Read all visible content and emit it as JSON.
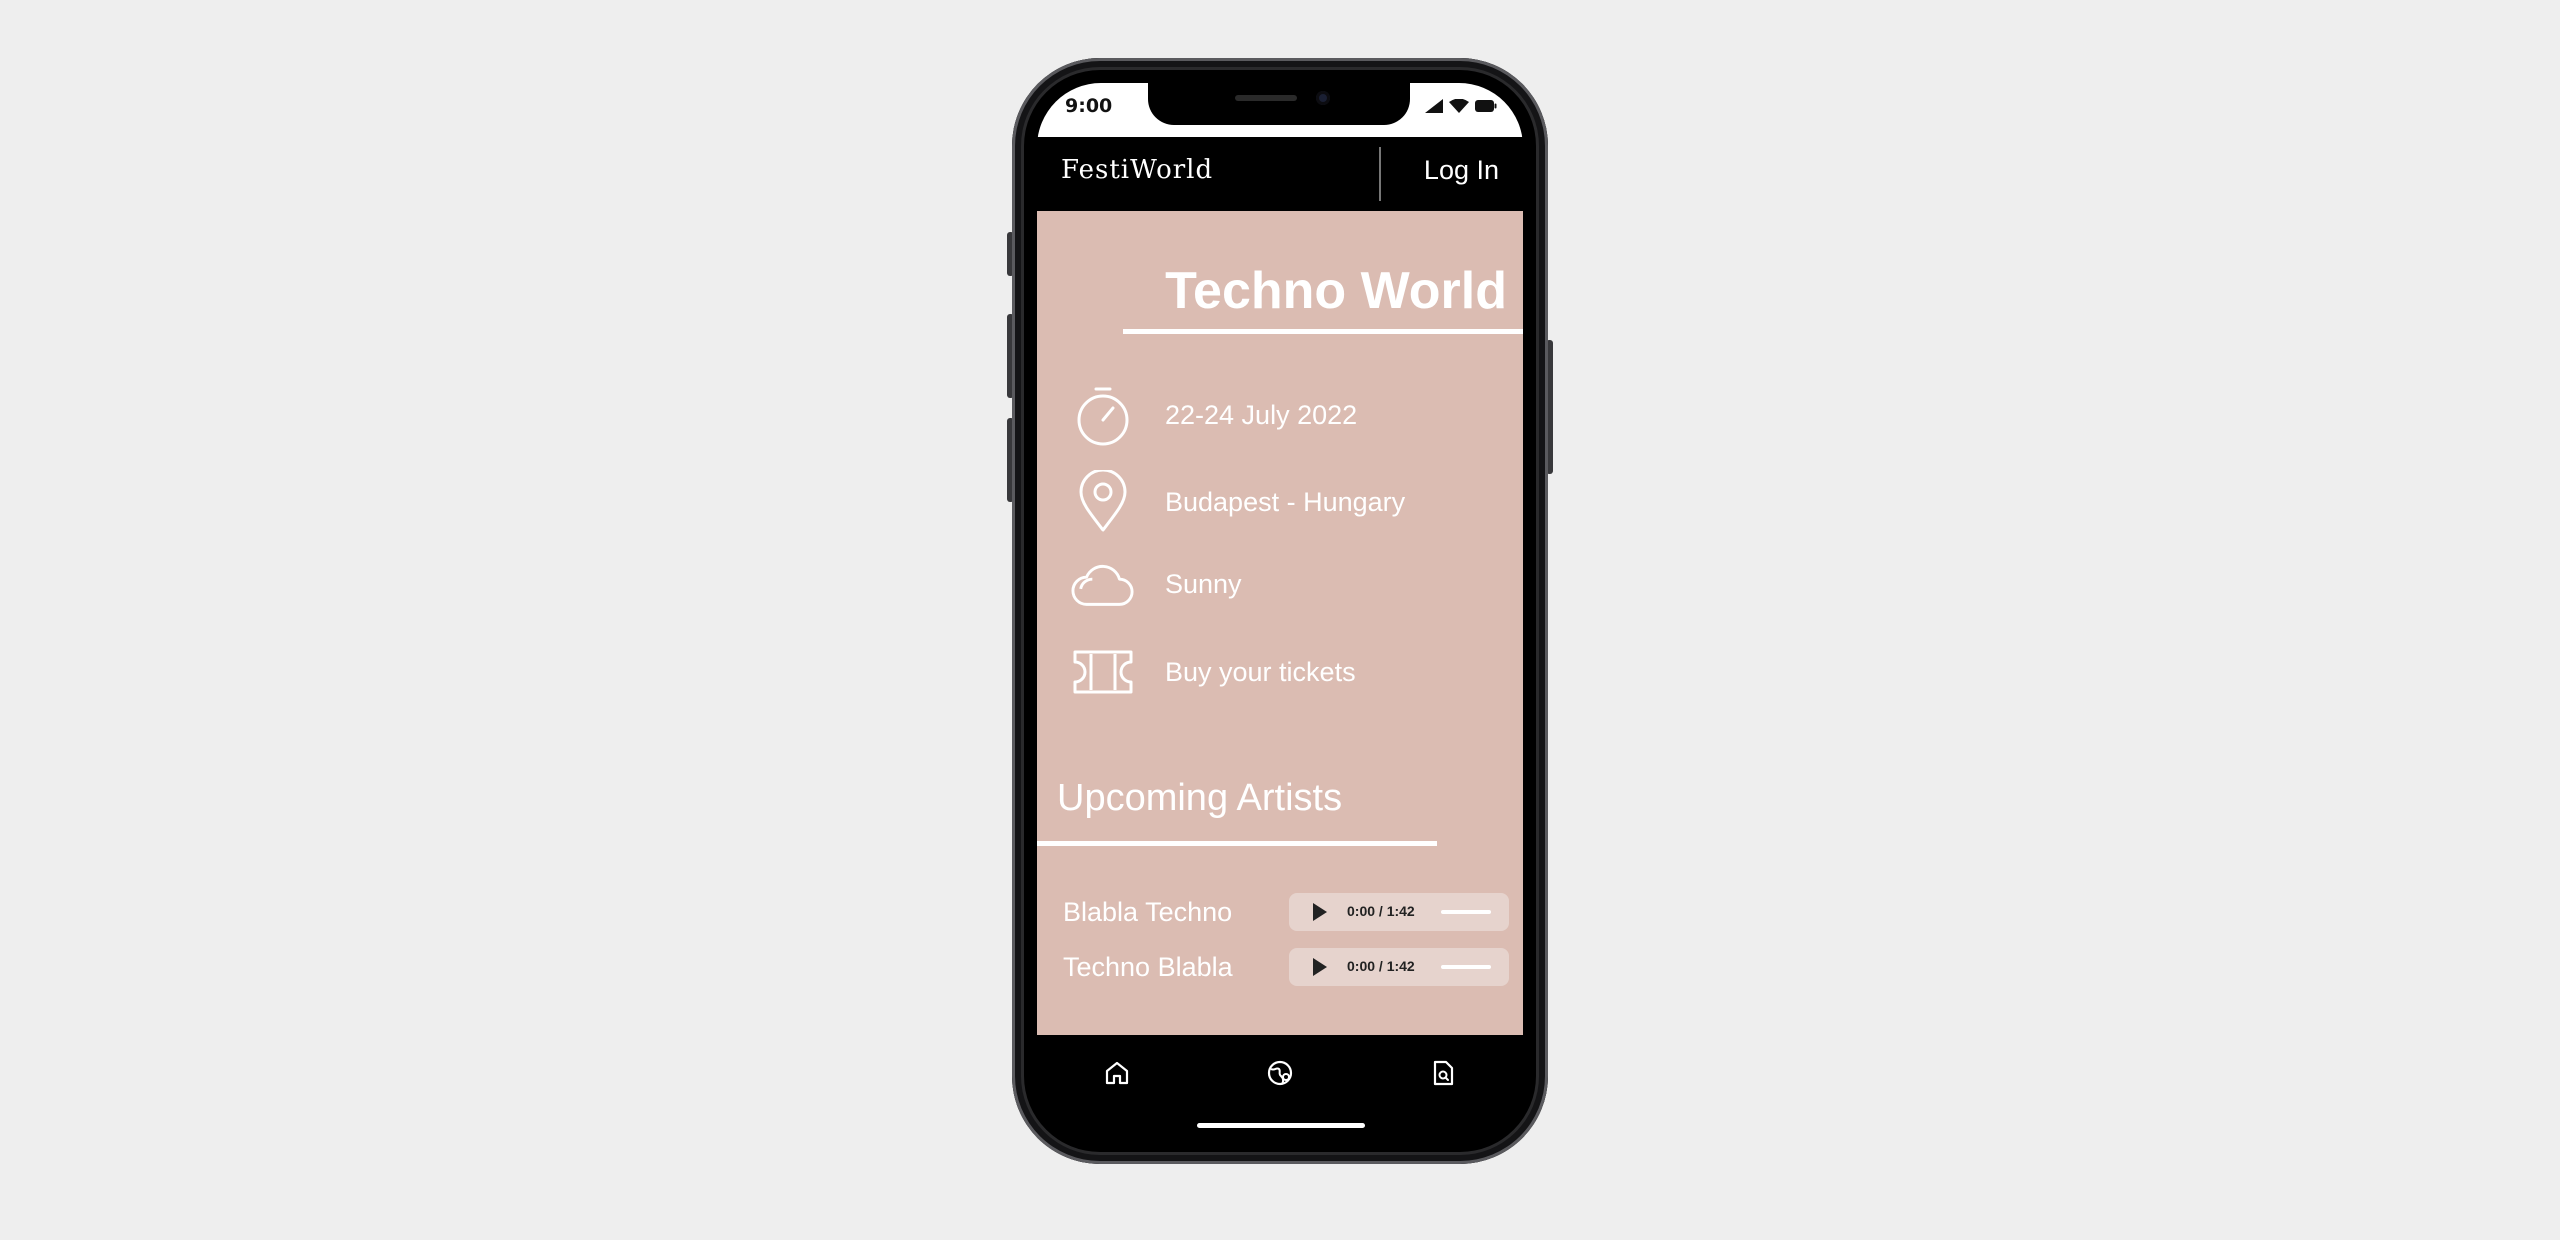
{
  "status_bar": {
    "time": "9:00"
  },
  "app_bar": {
    "logo": "FestiWorld",
    "login_label": "Log In"
  },
  "festival": {
    "title": "Techno World",
    "details": [
      {
        "icon": "stopwatch-icon",
        "text": "22-24 July 2022"
      },
      {
        "icon": "location-pin-icon",
        "text": "Budapest - Hungary"
      },
      {
        "icon": "cloud-icon",
        "text": "Sunny"
      },
      {
        "icon": "ticket-icon",
        "text": "Buy your tickets"
      }
    ]
  },
  "artists": {
    "heading": "Upcoming Artists",
    "tracks": [
      {
        "name": "Blabla Techno",
        "time": "0:00 / 1:42"
      },
      {
        "name": "Techno Blabla",
        "time": "0:00 / 1:42"
      }
    ]
  },
  "bottom_nav": {
    "items": [
      {
        "icon": "home-icon"
      },
      {
        "icon": "globe-icon"
      },
      {
        "icon": "document-search-icon"
      }
    ]
  },
  "colors": {
    "content_background": "#dbbcb2",
    "app_bar": "#000000",
    "text": "#ffffff",
    "page_background": "#eeeeee"
  }
}
